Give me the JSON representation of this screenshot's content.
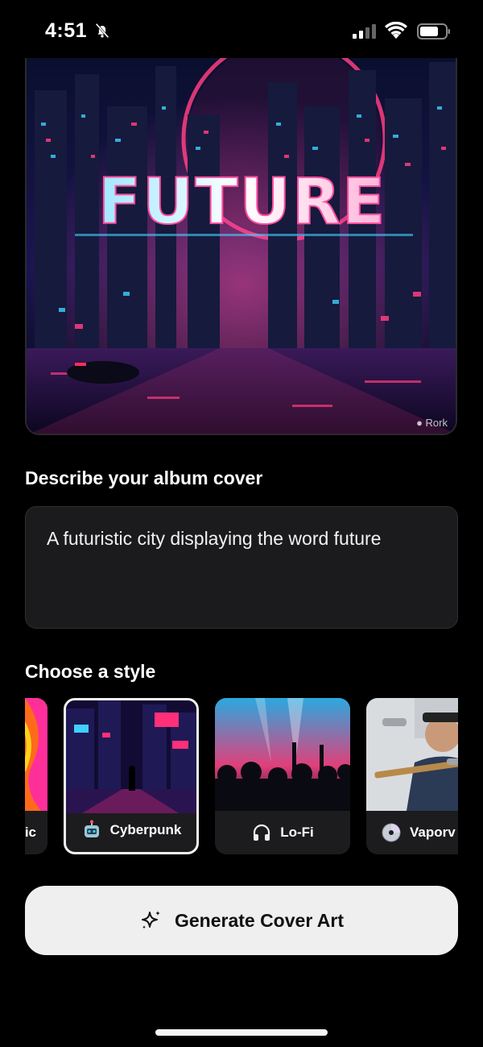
{
  "status": {
    "time": "4:51"
  },
  "hero": {
    "overlay_text": "FUTURE",
    "watermark": "Rork"
  },
  "describe": {
    "heading": "Describe your album cover",
    "prompt": "A futuristic city displaying the word future"
  },
  "style": {
    "heading": "Choose a style",
    "cards": [
      {
        "label": "ic",
        "icon": "partial-hidden",
        "selected": false
      },
      {
        "label": "Cyberpunk",
        "icon": "robot-icon",
        "selected": true
      },
      {
        "label": "Lo-Fi",
        "icon": "headphones-icon",
        "selected": false
      },
      {
        "label": "Vaporv",
        "icon": "disc-icon",
        "selected": false
      }
    ]
  },
  "generate": {
    "label": "Generate Cover Art",
    "icon": "sparkles-icon"
  },
  "colors": {
    "accent_pink": "#ff2f7a",
    "accent_cyan": "#3fd0ff",
    "button_bg": "#efefef"
  }
}
